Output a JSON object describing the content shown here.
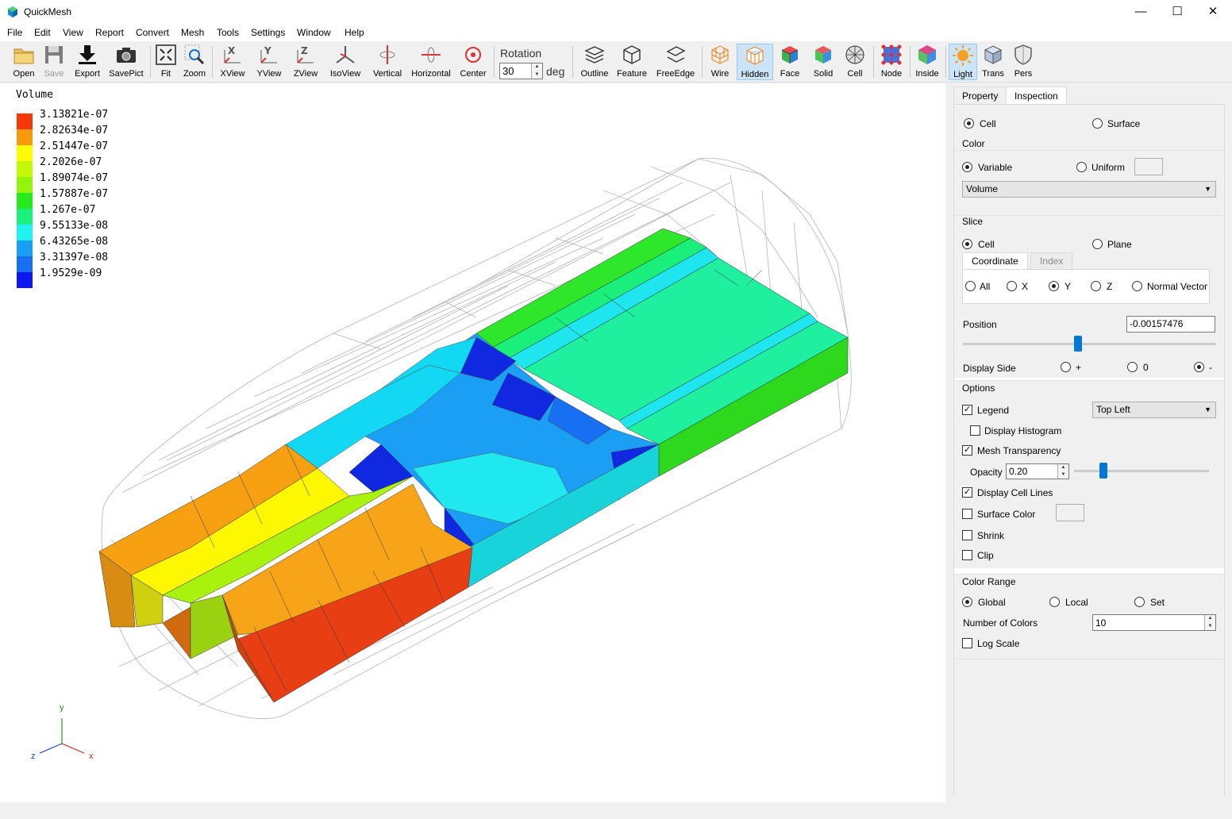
{
  "window": {
    "title": "QuickMesh",
    "minimize": "—",
    "maximize": "☐",
    "close": "✕"
  },
  "menu": [
    "File",
    "Edit",
    "View",
    "Report",
    "Convert",
    "Mesh",
    "Tools",
    "Settings",
    "Window",
    "Help"
  ],
  "toolbar": {
    "open": "Open",
    "save": "Save",
    "export": "Export",
    "savepict": "SavePict",
    "fit": "Fit",
    "zoom": "Zoom",
    "xview": "XView",
    "yview": "YView",
    "zview": "ZView",
    "isoview": "IsoView",
    "vertical": "Vertical",
    "horizontal": "Horizontal",
    "center": "Center",
    "rotation_label": "Rotation",
    "rotation_value": "30",
    "rotation_unit": "deg",
    "outline": "Outline",
    "feature": "Feature",
    "freeedge": "FreeEdge",
    "wire": "Wire",
    "hidden": "Hidden",
    "face": "Face",
    "solid": "Solid",
    "cell": "Cell",
    "node": "Node",
    "inside": "Inside",
    "light": "Light",
    "trans": "Trans",
    "pers": "Pers"
  },
  "legend": {
    "title": "Volume",
    "entries": [
      {
        "value": "3.13821e-07",
        "color": "#f5380b"
      },
      {
        "value": "2.82634e-07",
        "color": "#f89a0b"
      },
      {
        "value": "2.51447e-07",
        "color": "#fdfc01"
      },
      {
        "value": "2.2026e-07",
        "color": "#c4f80b"
      },
      {
        "value": "1.89074e-07",
        "color": "#93f50e"
      },
      {
        "value": "1.57887e-07",
        "color": "#25ea1b"
      },
      {
        "value": "1.267e-07",
        "color": "#1df07c"
      },
      {
        "value": "9.55133e-08",
        "color": "#20f2f0"
      },
      {
        "value": "6.43265e-08",
        "color": "#1a9ff5"
      },
      {
        "value": "3.31397e-08",
        "color": "#1670f1"
      },
      {
        "value": "1.9529e-09",
        "color": "#0f17ef"
      }
    ]
  },
  "axes": {
    "y": "y",
    "z": "z",
    "x": "x"
  },
  "panel": {
    "tabs": [
      "Property",
      "Inspection"
    ],
    "mode": {
      "cell": "Cell",
      "surface": "Surface"
    },
    "color": {
      "title": "Color",
      "variable": "Variable",
      "uniform": "Uniform",
      "selected": "Volume"
    },
    "slice": {
      "title": "Slice",
      "cell": "Cell",
      "plane": "Plane",
      "subtabs": [
        "Coordinate",
        "Index"
      ],
      "axes": [
        "All",
        "X",
        "Y",
        "Z",
        "Normal Vector"
      ],
      "position_label": "Position",
      "position_value": "-0.00157476",
      "display_side": "Display Side",
      "side_plus": "+",
      "side_zero": "0",
      "side_minus": "-"
    },
    "options": {
      "title": "Options",
      "legend": "Legend",
      "legend_pos": "Top Left",
      "histogram": "Display Histogram",
      "mesh_transparency": "Mesh Transparency",
      "opacity_label": "Opacity",
      "opacity_value": "0.20",
      "cell_lines": "Display Cell Lines",
      "surface_color": "Surface Color",
      "shrink": "Shrink",
      "clip": "Clip"
    },
    "color_range": {
      "title": "Color Range",
      "global": "Global",
      "local": "Local",
      "set": "Set",
      "num_colors_label": "Number of Colors",
      "num_colors_value": "10",
      "log_scale": "Log Scale"
    }
  }
}
